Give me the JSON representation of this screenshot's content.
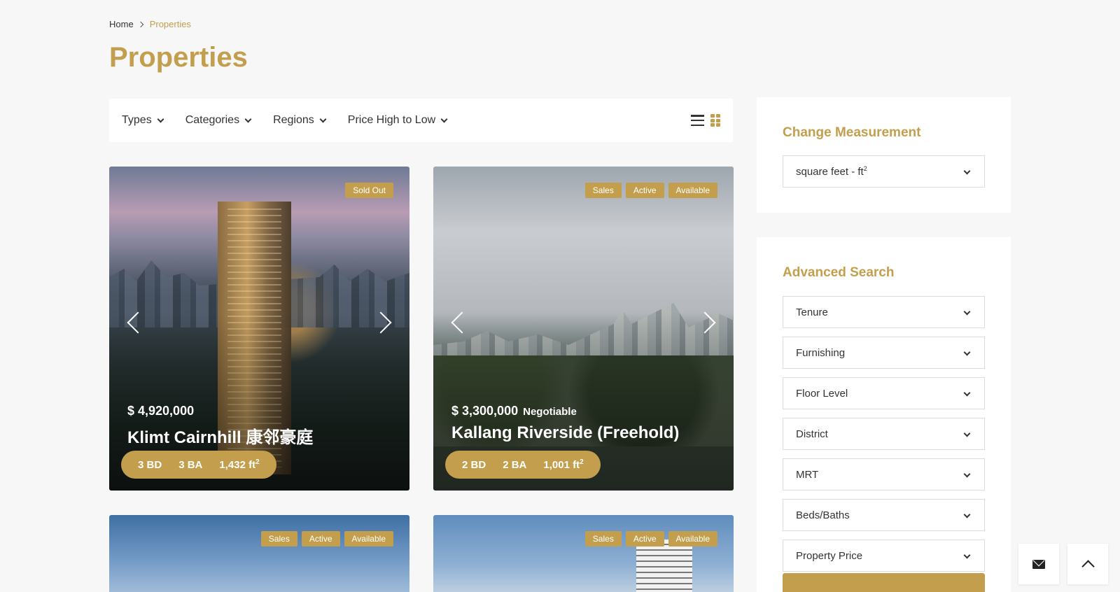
{
  "breadcrumb": {
    "home": "Home",
    "current": "Properties"
  },
  "page": {
    "title": "Properties"
  },
  "filters": {
    "types": "Types",
    "categories": "Categories",
    "regions": "Regions",
    "sort": "Price High to Low"
  },
  "view_toggles": [
    "list-view-icon",
    "grid-view-icon"
  ],
  "listings": [
    {
      "badges": [
        "Sold Out"
      ],
      "price": "$ 4,920,000",
      "price_note": "",
      "name": "Klimt Cairnhill 康邻豪庭",
      "beds": "3 BD",
      "baths": "3 BA",
      "area": "1,432 ft",
      "area_sup": "2"
    },
    {
      "badges": [
        "Sales",
        "Active",
        "Available"
      ],
      "price": "$ 3,300,000",
      "price_note": "Negotiable",
      "name": "Kallang Riverside (Freehold)",
      "beds": "2 BD",
      "baths": "2 BA",
      "area": "1,001 ft",
      "area_sup": "2"
    },
    {
      "badges": [
        "Sales",
        "Active",
        "Available"
      ]
    },
    {
      "badges": [
        "Sales",
        "Active",
        "Available"
      ]
    }
  ],
  "sidebar": {
    "measurement": {
      "title": "Change Measurement",
      "value": "square feet - ft",
      "value_sup": "2"
    },
    "advanced_search": {
      "title": "Advanced Search",
      "fields": [
        "Tenure",
        "Furnishing",
        "Floor Level",
        "District",
        "MRT",
        "Beds/Baths",
        "Property Price"
      ]
    }
  },
  "floating": [
    "mail-icon",
    "arrow-up-icon"
  ],
  "colors": {
    "accent": "#c39f4d",
    "background": "#f7f7f7"
  }
}
